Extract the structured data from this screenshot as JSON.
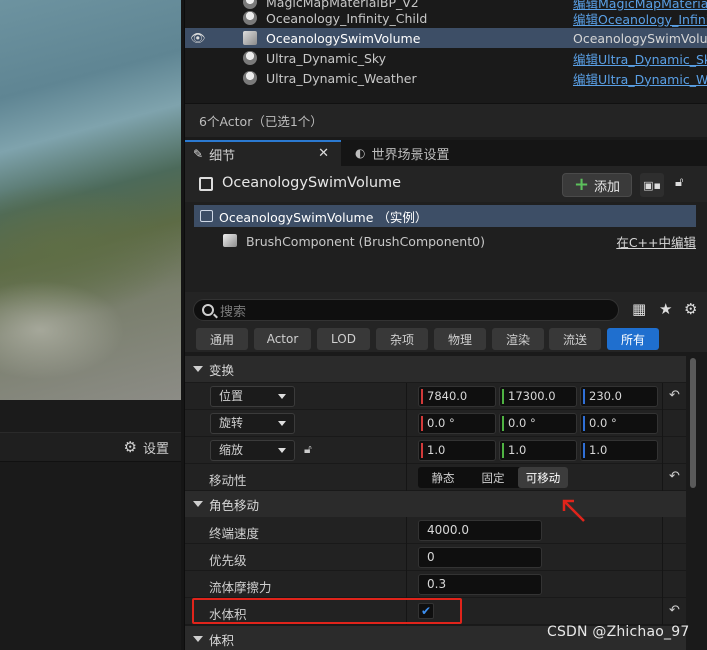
{
  "settings_label": "设置",
  "outliner": {
    "rows": [
      {
        "name": "MagicMapMaterialBP_V2",
        "type": "编辑MagicMapMateriaB"
      },
      {
        "name": "Oceanology_Infinity_Child",
        "type": "编辑Oceanology_Infinit"
      },
      {
        "name": "OceanologySwimVolume",
        "type": "OceanologySwimVolum"
      },
      {
        "name": "Ultra_Dynamic_Sky",
        "type": "编辑Ultra_Dynamic_Sk"
      },
      {
        "name": "Ultra_Dynamic_Weather",
        "type": "编辑Ultra_Dynamic_We"
      }
    ],
    "status": "6个Actor（已选1个）"
  },
  "tabs": {
    "details": "细节",
    "world_settings": "世界场景设置"
  },
  "details": {
    "actor_name": "OceanologySwimVolume",
    "add_label": "添加",
    "component_instance": "OceanologySwimVolume （实例）",
    "component_brush": "BrushComponent (BrushComponent0)",
    "edit_cpp": "在C++中编辑",
    "search_placeholder": "搜索",
    "filters": [
      "通用",
      "Actor",
      "LOD",
      "杂项",
      "物理",
      "渲染",
      "流送",
      "所有"
    ]
  },
  "transform": {
    "category": "变换",
    "location_label": "位置",
    "location": [
      "7840.0",
      "17300.0",
      "230.0"
    ],
    "rotation_label": "旋转",
    "rotation": [
      "0.0 °",
      "0.0 °",
      "0.0 °"
    ],
    "scale_label": "缩放",
    "scale": [
      "1.0",
      "1.0",
      "1.0"
    ],
    "mobility_label": "移动性",
    "mobility_options": [
      "静态",
      "固定",
      "可移动"
    ],
    "mobility_selected": "可移动"
  },
  "character_movement": {
    "category": "角色移动",
    "terminal_velocity_label": "终端速度",
    "terminal_velocity": "4000.0",
    "priority_label": "优先级",
    "priority": "0",
    "fluid_friction_label": "流体摩擦力",
    "fluid_friction": "0.3",
    "water_volume_label": "水体积",
    "water_volume_checked": true
  },
  "volume": {
    "category": "体积"
  },
  "watermark": "CSDN @Zhichao_97",
  "colors": {
    "accent": "#1f6fcf",
    "selection": "#3d4e66",
    "annotation_red": "#e0241b"
  }
}
